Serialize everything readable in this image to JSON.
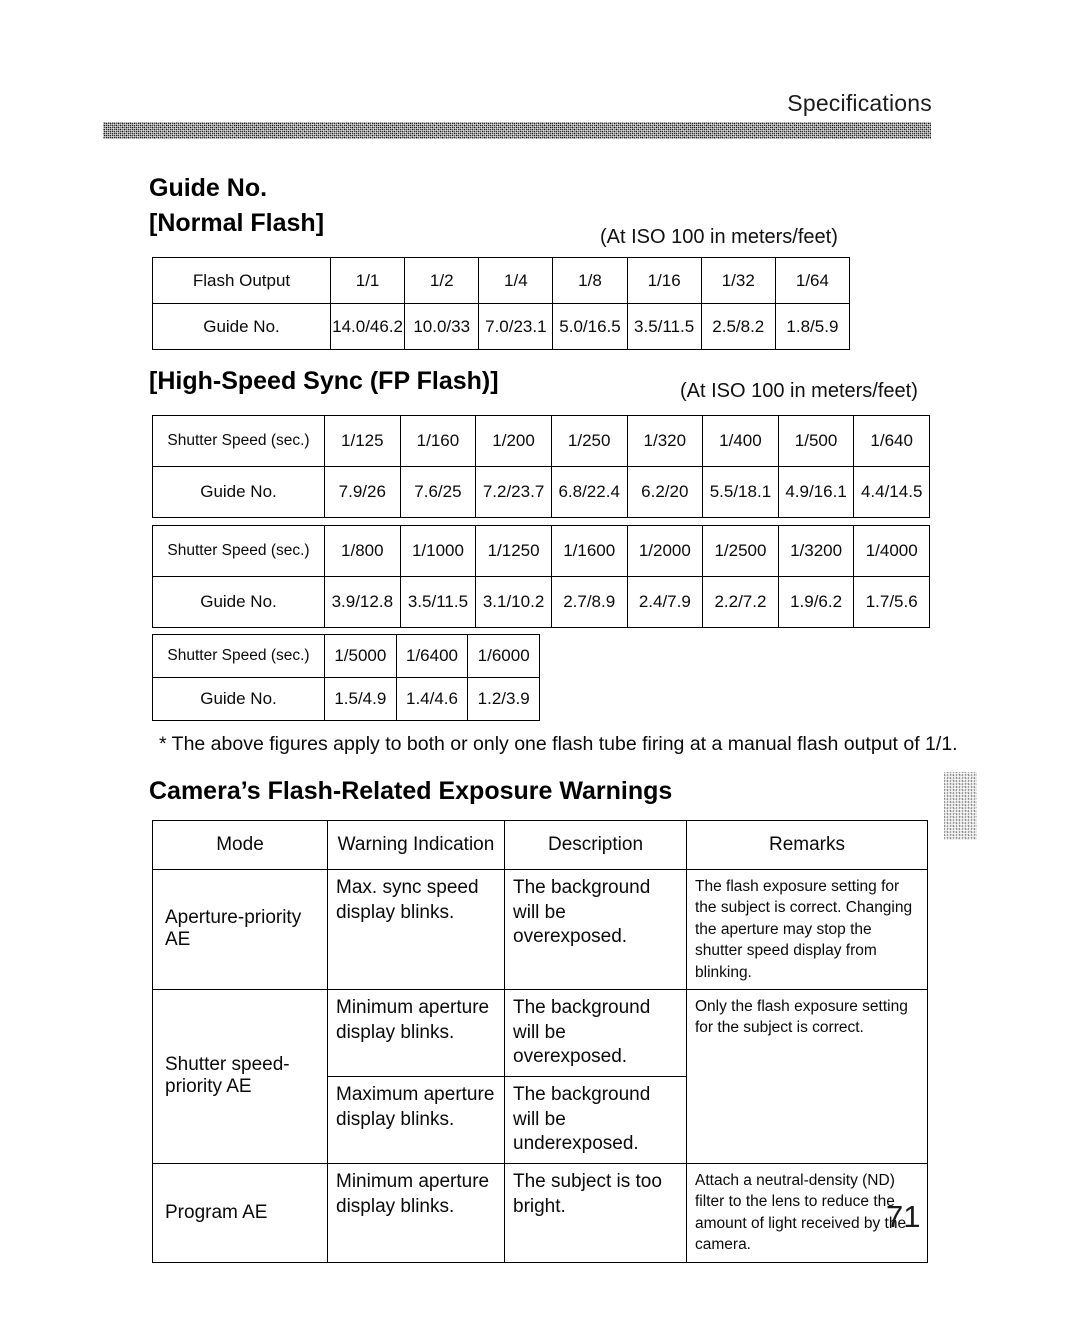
{
  "header": {
    "running_head": "Specifications"
  },
  "sections": {
    "guide_no_title": "Guide No.",
    "normal_flash_title": "[Normal Flash]",
    "fp_title": "[High-Speed Sync (FP Flash)]",
    "warnings_title": "Camera’s Flash-Related Exposure Warnings",
    "iso_note_1": "(At ISO 100 in meters/feet)",
    "iso_note_2": "(At ISO 100 in meters/feet)"
  },
  "normal_flash_table": {
    "row_labels": [
      "Flash Output",
      "Guide No."
    ],
    "flash_output": [
      "1/1",
      "1/2",
      "1/4",
      "1/8",
      "1/16",
      "1/32",
      "1/64"
    ],
    "guide_no": [
      "14.0/46.2",
      "10.0/33",
      "7.0/23.1",
      "5.0/16.5",
      "3.5/11.5",
      "2.5/8.2",
      "1.8/5.9"
    ]
  },
  "fp_tables": [
    {
      "row_labels": [
        "Shutter Speed (sec.)",
        "Guide No."
      ],
      "shutter_speed": [
        "1/125",
        "1/160",
        "1/200",
        "1/250",
        "1/320",
        "1/400",
        "1/500",
        "1/640"
      ],
      "guide_no": [
        "7.9/26",
        "7.6/25",
        "7.2/23.7",
        "6.8/22.4",
        "6.2/20",
        "5.5/18.1",
        "4.9/16.1",
        "4.4/14.5"
      ]
    },
    {
      "row_labels": [
        "Shutter Speed (sec.)",
        "Guide No."
      ],
      "shutter_speed": [
        "1/800",
        "1/1000",
        "1/1250",
        "1/1600",
        "1/2000",
        "1/2500",
        "1/3200",
        "1/4000"
      ],
      "guide_no": [
        "3.9/12.8",
        "3.5/11.5",
        "3.1/10.2",
        "2.7/8.9",
        "2.4/7.9",
        "2.2/7.2",
        "1.9/6.2",
        "1.7/5.6"
      ]
    },
    {
      "row_labels": [
        "Shutter Speed (sec.)",
        "Guide No."
      ],
      "shutter_speed": [
        "1/5000",
        "1/6400",
        "1/6000"
      ],
      "guide_no": [
        "1.5/4.9",
        "1.4/4.6",
        "1.2/3.9"
      ]
    }
  ],
  "footnote": "* The above figures apply to both or only one flash tube firing at a manual flash output of 1/1.",
  "warnings_table": {
    "headers": [
      "Mode",
      "Warning Indication",
      "Description",
      "Remarks"
    ],
    "rows": [
      {
        "mode": "Aperture-priority AE",
        "warning": "Max. sync speed display blinks.",
        "description": "The background will be overexposed.",
        "remarks": "The flash exposure setting for the subject is correct. Changing the aperture may stop the shutter speed display from blinking."
      },
      {
        "mode": "Shutter speed-priority AE",
        "warning": "Minimum aperture display blinks.",
        "description": "The background will be overexposed.",
        "remarks": "Only the flash exposure setting for the subject is correct."
      },
      {
        "mode": "",
        "warning": "Maximum aperture display blinks.",
        "description": "The background will be underexposed.",
        "remarks": ""
      },
      {
        "mode": "Program AE",
        "warning": "Minimum aperture display blinks.",
        "description": "The subject is too bright.",
        "remarks": "Attach a neutral-density (ND) filter to the lens to reduce the amount of light received by the camera."
      }
    ]
  },
  "folio": "71"
}
